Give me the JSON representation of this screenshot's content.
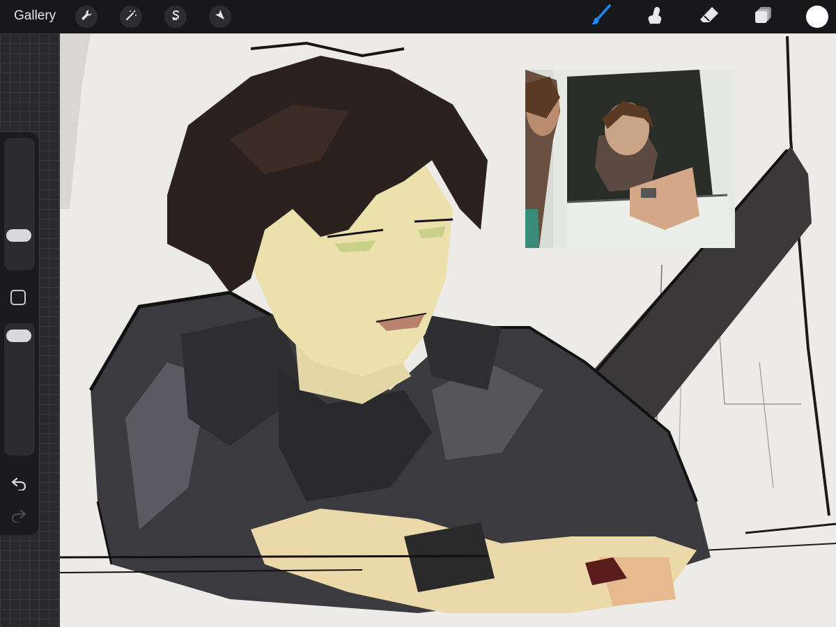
{
  "app": {
    "gallery_label": "Gallery"
  },
  "toolbar": {
    "left_tools": [
      {
        "name": "actions",
        "icon": "wrench-icon"
      },
      {
        "name": "adjustments",
        "icon": "magic-wand-icon"
      },
      {
        "name": "selection",
        "icon": "selection-s-icon"
      },
      {
        "name": "transform",
        "icon": "arrow-cursor-icon"
      }
    ],
    "right_tools": [
      {
        "name": "brush",
        "icon": "brush-icon",
        "active": true
      },
      {
        "name": "smudge",
        "icon": "smudge-finger-icon",
        "active": false
      },
      {
        "name": "eraser",
        "icon": "eraser-icon",
        "active": false
      },
      {
        "name": "layers",
        "icon": "layers-icon",
        "active": false
      }
    ],
    "current_color": "#ffffff",
    "active_color": "#1a8cff"
  },
  "sidebar": {
    "brush_size_level": 0.3,
    "opacity_level": 0.95,
    "undo_icon": "undo-icon",
    "redo_icon": "redo-icon",
    "modify_icon": "square-modify-icon"
  }
}
